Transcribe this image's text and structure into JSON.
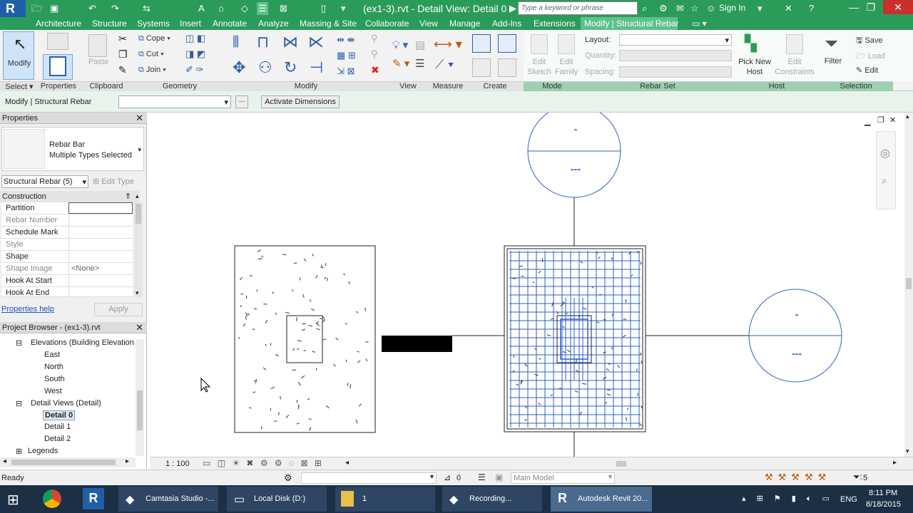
{
  "titlebar": {
    "title": "(ex1-3).rvt - Detail View: Detail 0",
    "search_placeholder": "Type a keyword or phrase",
    "sign_in": "Sign In"
  },
  "tabs": [
    "Architecture",
    "Structure",
    "Systems",
    "Insert",
    "Annotate",
    "Analyze",
    "Massing & Site",
    "Collaborate",
    "View",
    "Manage",
    "Add-Ins",
    "Extensions"
  ],
  "active_tab": "Modify | Structural Rebar",
  "ribbon": {
    "modify": "Modify",
    "paste": "Paste",
    "properties": "Properties",
    "cope": "Cope",
    "cut": "Cut",
    "join": "Join",
    "edit_sketch": "Edit\nSketch",
    "edit_family": "Edit\nFamily",
    "layout": "Layout:",
    "quantity": "Quantity:",
    "spacing": "Spacing:",
    "pick_new_host": "Pick New\nHost",
    "edit_constraints": "Edit\nConstraints",
    "filter": "Filter",
    "save": "Save",
    "load": "Load",
    "edit": "Edit",
    "panels": {
      "select": "Select ▾",
      "properties": "Properties",
      "clipboard": "Clipboard",
      "geometry": "Geometry",
      "modify": "Modify",
      "view": "View",
      "measure": "Measure",
      "create": "Create",
      "mode": "Mode",
      "rebar_set": "Rebar Set",
      "host": "Host",
      "selection": "Selection"
    }
  },
  "optbar": {
    "context": "Modify | Structural Rebar",
    "button": "...",
    "activate_dimensions": "Activate Dimensions"
  },
  "properties": {
    "title": "Properties",
    "type_line1": "Rebar Bar",
    "type_line2": "Multiple Types Selected",
    "filter_value": "Structural Rebar (5)",
    "edit_type": "Edit Type",
    "group": "Construction",
    "rows": [
      {
        "label": "Partition",
        "value": ""
      },
      {
        "label": "Rebar Number",
        "value": ""
      },
      {
        "label": "Schedule Mark",
        "value": ""
      },
      {
        "label": "Style",
        "value": ""
      },
      {
        "label": "Shape",
        "value": ""
      },
      {
        "label": "Shape Image",
        "value": "<None>"
      },
      {
        "label": "Hook At Start",
        "value": ""
      },
      {
        "label": "Hook At End",
        "value": ""
      }
    ],
    "help": "Properties help",
    "apply": "Apply"
  },
  "browser": {
    "title": "Project Browser - (ex1-3).rvt",
    "items": [
      {
        "label": "Elevations (Building Elevation"
      },
      {
        "label": "East"
      },
      {
        "label": "North"
      },
      {
        "label": "South"
      },
      {
        "label": "West"
      },
      {
        "label": "Detail Views (Detail)"
      },
      {
        "label": "Detail 0"
      },
      {
        "label": "Detail 1"
      },
      {
        "label": "Detail 2"
      },
      {
        "label": "Legends"
      }
    ]
  },
  "canvas": {
    "callout_top": "-",
    "callout_bottom": "---",
    "callout_right_top": "-",
    "callout_right_bottom": "---"
  },
  "viewbar": {
    "scale": "1 : 100"
  },
  "status": {
    "text": "Ready",
    "filter_count": "0",
    "model": "Main Model",
    "selection_count": "5"
  },
  "taskbar": {
    "items": [
      "Camtasia Studio -...",
      "Local Disk (D:)",
      "1",
      "Recording...",
      "Autodesk Revit 20..."
    ],
    "lang": "ENG",
    "time": "8:11 PM",
    "date": "8/18/2015"
  },
  "colors": {
    "accent": "#2b9b5a",
    "rebar_blue": "#2f5ec4"
  }
}
